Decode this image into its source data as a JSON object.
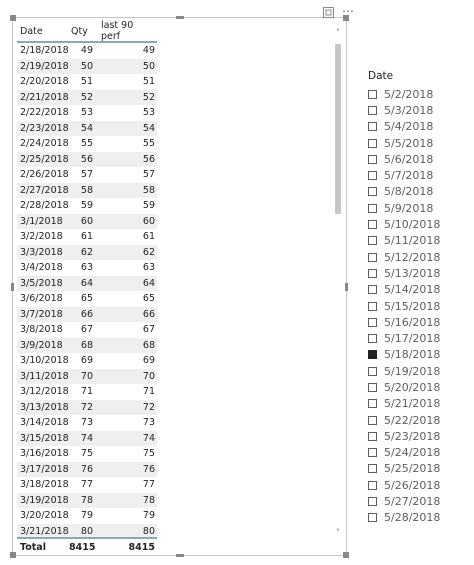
{
  "table": {
    "headers": {
      "date": "Date",
      "qty": "Qty",
      "perf": "last 90 perf"
    },
    "rows": [
      {
        "date": "2/18/2018",
        "qty": "49",
        "perf": "49"
      },
      {
        "date": "2/19/2018",
        "qty": "50",
        "perf": "50"
      },
      {
        "date": "2/20/2018",
        "qty": "51",
        "perf": "51"
      },
      {
        "date": "2/21/2018",
        "qty": "52",
        "perf": "52"
      },
      {
        "date": "2/22/2018",
        "qty": "53",
        "perf": "53"
      },
      {
        "date": "2/23/2018",
        "qty": "54",
        "perf": "54"
      },
      {
        "date": "2/24/2018",
        "qty": "55",
        "perf": "55"
      },
      {
        "date": "2/25/2018",
        "qty": "56",
        "perf": "56"
      },
      {
        "date": "2/26/2018",
        "qty": "57",
        "perf": "57"
      },
      {
        "date": "2/27/2018",
        "qty": "58",
        "perf": "58"
      },
      {
        "date": "2/28/2018",
        "qty": "59",
        "perf": "59"
      },
      {
        "date": "3/1/2018",
        "qty": "60",
        "perf": "60"
      },
      {
        "date": "3/2/2018",
        "qty": "61",
        "perf": "61"
      },
      {
        "date": "3/3/2018",
        "qty": "62",
        "perf": "62"
      },
      {
        "date": "3/4/2018",
        "qty": "63",
        "perf": "63"
      },
      {
        "date": "3/5/2018",
        "qty": "64",
        "perf": "64"
      },
      {
        "date": "3/6/2018",
        "qty": "65",
        "perf": "65"
      },
      {
        "date": "3/7/2018",
        "qty": "66",
        "perf": "66"
      },
      {
        "date": "3/8/2018",
        "qty": "67",
        "perf": "67"
      },
      {
        "date": "3/9/2018",
        "qty": "68",
        "perf": "68"
      },
      {
        "date": "3/10/2018",
        "qty": "69",
        "perf": "69"
      },
      {
        "date": "3/11/2018",
        "qty": "70",
        "perf": "70"
      },
      {
        "date": "3/12/2018",
        "qty": "71",
        "perf": "71"
      },
      {
        "date": "3/13/2018",
        "qty": "72",
        "perf": "72"
      },
      {
        "date": "3/14/2018",
        "qty": "73",
        "perf": "73"
      },
      {
        "date": "3/15/2018",
        "qty": "74",
        "perf": "74"
      },
      {
        "date": "3/16/2018",
        "qty": "75",
        "perf": "75"
      },
      {
        "date": "3/17/2018",
        "qty": "76",
        "perf": "76"
      },
      {
        "date": "3/18/2018",
        "qty": "77",
        "perf": "77"
      },
      {
        "date": "3/19/2018",
        "qty": "78",
        "perf": "78"
      },
      {
        "date": "3/20/2018",
        "qty": "79",
        "perf": "79"
      },
      {
        "date": "3/21/2018",
        "qty": "80",
        "perf": "80"
      }
    ],
    "total": {
      "label": "Total",
      "qty": "8415",
      "perf": "8415"
    },
    "header_icons": {
      "focus": "focus-mode-icon",
      "more": "…"
    },
    "scroll": {
      "up": "˄",
      "down": "˅"
    }
  },
  "slicer": {
    "title": "Date",
    "items": [
      {
        "label": "5/2/2018",
        "checked": false
      },
      {
        "label": "5/3/2018",
        "checked": false
      },
      {
        "label": "5/4/2018",
        "checked": false
      },
      {
        "label": "5/5/2018",
        "checked": false
      },
      {
        "label": "5/6/2018",
        "checked": false
      },
      {
        "label": "5/7/2018",
        "checked": false
      },
      {
        "label": "5/8/2018",
        "checked": false
      },
      {
        "label": "5/9/2018",
        "checked": false
      },
      {
        "label": "5/10/2018",
        "checked": false
      },
      {
        "label": "5/11/2018",
        "checked": false
      },
      {
        "label": "5/12/2018",
        "checked": false
      },
      {
        "label": "5/13/2018",
        "checked": false
      },
      {
        "label": "5/14/2018",
        "checked": false
      },
      {
        "label": "5/15/2018",
        "checked": false
      },
      {
        "label": "5/16/2018",
        "checked": false
      },
      {
        "label": "5/17/2018",
        "checked": false
      },
      {
        "label": "5/18/2018",
        "checked": true
      },
      {
        "label": "5/19/2018",
        "checked": false
      },
      {
        "label": "5/20/2018",
        "checked": false
      },
      {
        "label": "5/21/2018",
        "checked": false
      },
      {
        "label": "5/22/2018",
        "checked": false
      },
      {
        "label": "5/23/2018",
        "checked": false
      },
      {
        "label": "5/24/2018",
        "checked": false
      },
      {
        "label": "5/25/2018",
        "checked": false
      },
      {
        "label": "5/26/2018",
        "checked": false
      },
      {
        "label": "5/27/2018",
        "checked": false
      },
      {
        "label": "5/28/2018",
        "checked": false
      }
    ]
  },
  "colors": {
    "header_rule": "#8aa6c1",
    "banded_row": "#efefef",
    "selected_checkbox": "#252423"
  }
}
